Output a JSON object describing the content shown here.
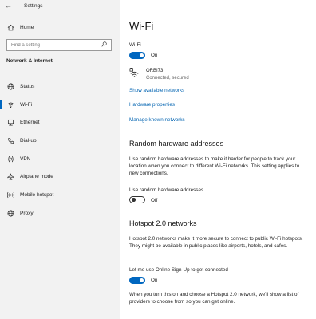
{
  "window": {
    "title": "Settings"
  },
  "sidebar": {
    "home_label": "Home",
    "search_placeholder": "Find a setting",
    "section_heading": "Network & Internet",
    "items": [
      {
        "label": "Status"
      },
      {
        "label": "Wi-Fi",
        "selected": true
      },
      {
        "label": "Ethernet"
      },
      {
        "label": "Dial-up"
      },
      {
        "label": "VPN"
      },
      {
        "label": "Airplane mode"
      },
      {
        "label": "Mobile hotspot"
      },
      {
        "label": "Proxy"
      }
    ]
  },
  "main": {
    "title": "Wi-Fi",
    "wifi_label": "Wi-Fi",
    "wifi_toggle_state": "On",
    "network": {
      "name": "ORBI73",
      "status": "Connected, secured"
    },
    "links": {
      "show_networks": "Show available networks",
      "hardware_properties": "Hardware properties",
      "manage_networks": "Manage known networks"
    },
    "random_hw": {
      "title": "Random hardware addresses",
      "description": "Use random hardware addresses to make it harder for people to track your location when you connect to different Wi-Fi networks. This setting applies to new connections.",
      "toggle_label": "Use random hardware addresses",
      "toggle_state": "Off"
    },
    "hotspot": {
      "title": "Hotspot 2.0 networks",
      "description": "Hotspot 2.0 networks make it more secure to connect to public Wi-Fi hotspots. They might be available in public places like airports, hotels, and cafes.",
      "toggle_label": "Let me use Online Sign-Up to get connected",
      "toggle_state": "On",
      "footer": "When you turn this on and choose a Hotspot 2.0 network, we'll show a list of providers to choose from so you can get online."
    }
  },
  "colors": {
    "accent": "#0067c0",
    "link": "#0063b1",
    "sidebar_bg": "#f2f2f2"
  }
}
